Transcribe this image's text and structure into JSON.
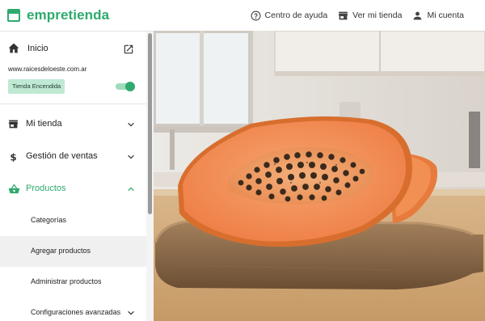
{
  "brand": {
    "name": "empretienda",
    "color": "#2eaa6e"
  },
  "top_actions": {
    "help": {
      "label": "Centro de ayuda",
      "icon": "help-circle-icon"
    },
    "store": {
      "label": "Ver mi tienda",
      "icon": "store-icon"
    },
    "account": {
      "label": "Mi cuenta",
      "icon": "person-icon"
    }
  },
  "sidebar": {
    "home": {
      "label": "Inicio",
      "icon": "home-icon",
      "link_icon": "open-in-new-icon"
    },
    "store_url": "www.raicesdeloeste.com.ar",
    "status_badge": "Tienda Encendida",
    "store_on": true,
    "items": [
      {
        "label": "Mi tienda",
        "icon": "store-icon",
        "expanded": false
      },
      {
        "label": "Gestión de ventas",
        "icon": "dollar-icon",
        "expanded": false
      },
      {
        "label": "Productos",
        "icon": "basket-icon",
        "expanded": true
      }
    ],
    "subitems": [
      {
        "label": "Categorías",
        "selected": false
      },
      {
        "label": "Agregar productos",
        "selected": true
      },
      {
        "label": "Administrar productos",
        "selected": false
      },
      {
        "label": "Configuraciones avanzadas",
        "selected": false,
        "has_chevron": true
      }
    ]
  },
  "main": {
    "image": "papaya-on-cutting-board"
  }
}
